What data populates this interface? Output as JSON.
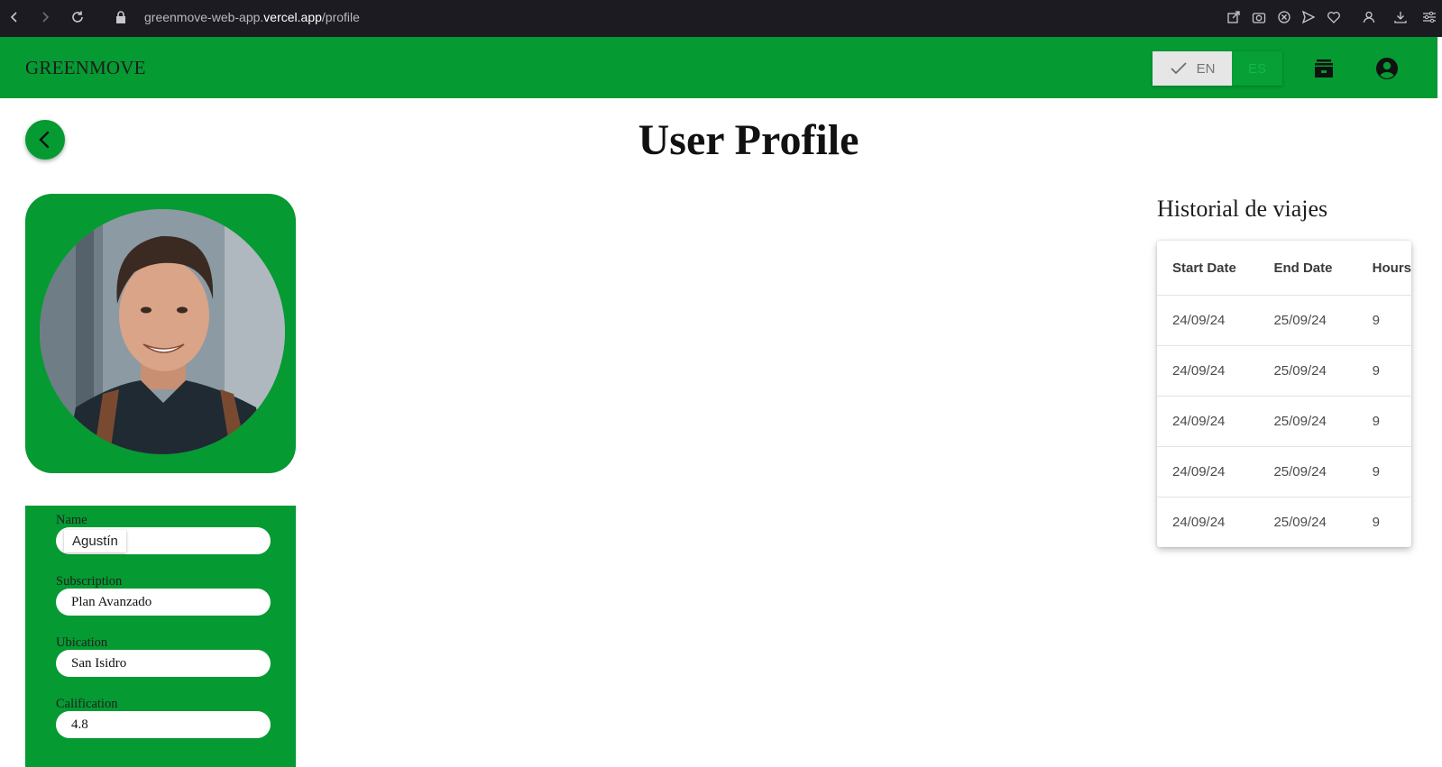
{
  "browser": {
    "url_prefix": "greenmove-web-app.",
    "url_domain": "vercel.app",
    "url_path": "/profile"
  },
  "navbar": {
    "brand": "GREENMOVE",
    "lang_en": "EN",
    "lang_es": "ES",
    "bg_color": "#059a32"
  },
  "page": {
    "title": "User Profile"
  },
  "profile": {
    "name_label": "Name",
    "name_value": "Agustín",
    "subscription_label": "Subscription",
    "subscription_value": "Plan Avanzado",
    "ubication_label": "Ubication",
    "ubication_value": "San Isidro",
    "calification_label": "Calification",
    "calification_value": "4.8"
  },
  "history": {
    "title": "Historial de viajes",
    "columns": [
      "Start Date",
      "End Date",
      "Hours"
    ],
    "rows": [
      [
        "24/09/24",
        "25/09/24",
        "9"
      ],
      [
        "24/09/24",
        "25/09/24",
        "9"
      ],
      [
        "24/09/24",
        "25/09/24",
        "9"
      ],
      [
        "24/09/24",
        "25/09/24",
        "9"
      ],
      [
        "24/09/24",
        "25/09/24",
        "9"
      ]
    ]
  },
  "icons": {
    "back": "chevron-left-icon",
    "vehicle": "scooter-icon",
    "account": "account-circle-icon"
  }
}
